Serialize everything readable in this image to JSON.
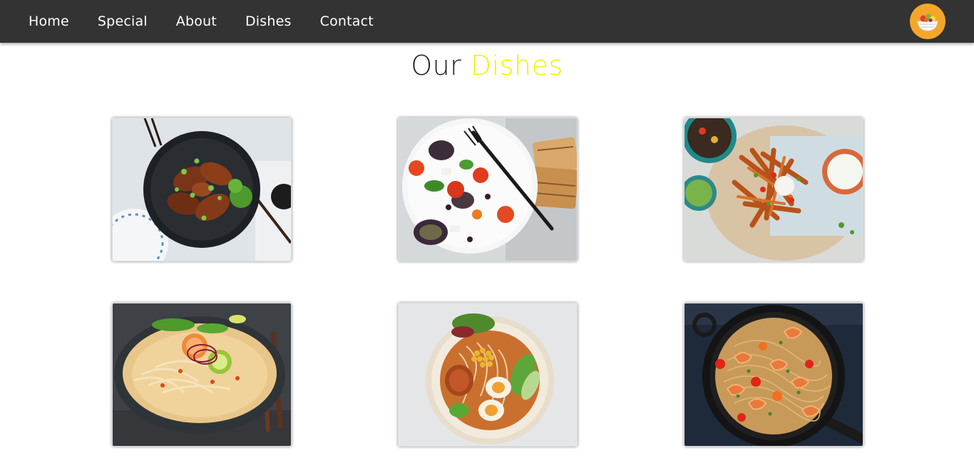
{
  "nav": {
    "items": [
      {
        "label": "Home"
      },
      {
        "label": "Special"
      },
      {
        "label": "About"
      },
      {
        "label": "Dishes"
      },
      {
        "label": "Contact"
      }
    ],
    "logo_icon": "salad-bowl-icon"
  },
  "heading": {
    "part1": "Our",
    "part2": "Dishes"
  },
  "colors": {
    "navbar_bg": "#333333",
    "accent": "#f5f000",
    "logo_bg": "#f4a62a"
  },
  "dishes": [
    {
      "image": "chicken-wings-bowl"
    },
    {
      "image": "mediterranean-salad-plate"
    },
    {
      "image": "sweet-potato-fries-board"
    },
    {
      "image": "curry-noodle-soup-bowl"
    },
    {
      "image": "ramen-egg-bowl"
    },
    {
      "image": "shrimp-spaghetti-pan"
    }
  ]
}
